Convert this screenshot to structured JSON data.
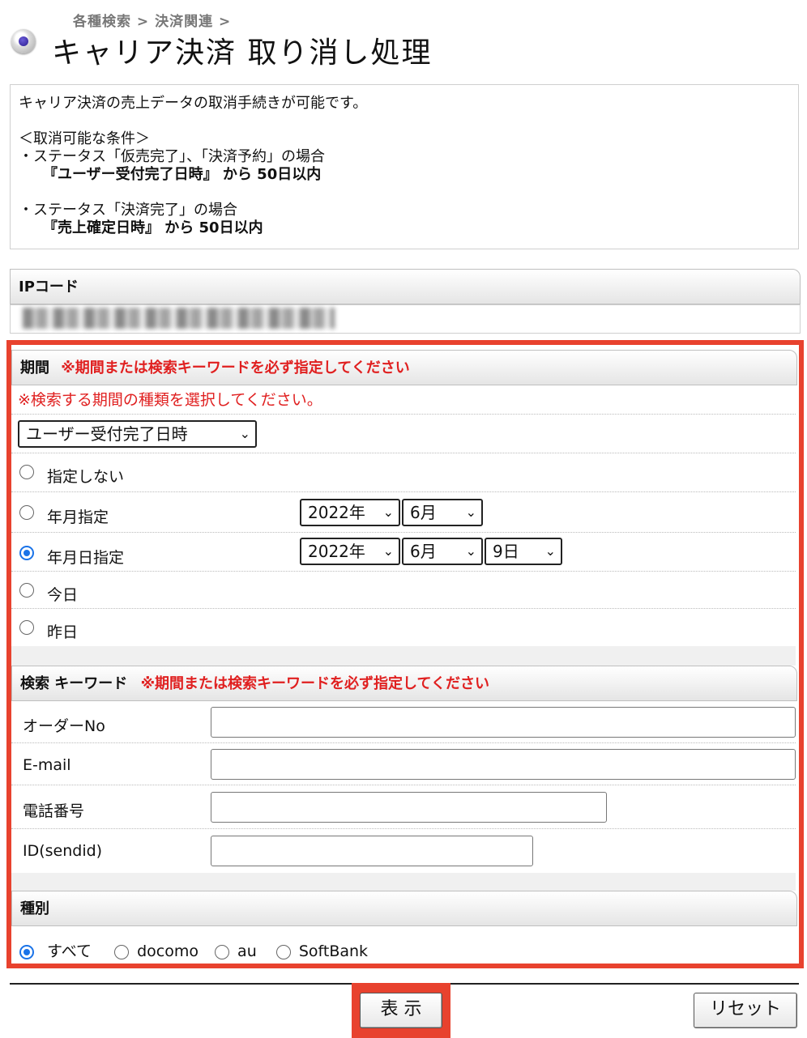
{
  "breadcrumb": "各種検索 > 決済関連 >",
  "title": "キャリア決済 取り消し処理",
  "info": {
    "line1": "キャリア決済の売上データの取消手続きが可能です。",
    "conditions_header": "＜取消可能な条件＞",
    "cond1": "・ステータス「仮売完了」、「決済予約」の場合",
    "cond1_detail": "『ユーザー受付完了日時』 から 50日以内",
    "cond2": "・ステータス「決済完了」の場合",
    "cond2_detail": "『売上確定日時』 から 50日以内"
  },
  "ip_section": {
    "label": "IPコード"
  },
  "period": {
    "label": "期間",
    "required_note": "※期間または検索キーワードを必ず指定してください",
    "select_note": "※検索する期間の種類を選択してください。",
    "type_select": "ユーザー受付完了日時",
    "options": [
      "指定しない",
      "年月指定",
      "年月日指定",
      "今日",
      "昨日"
    ],
    "selected": "年月日指定",
    "ym": {
      "year": "2022年",
      "month": "6月"
    },
    "ymd": {
      "year": "2022年",
      "month": "6月",
      "day": "9日"
    }
  },
  "keyword": {
    "label": "検索 キーワード",
    "required_note": "※期間または検索キーワードを必ず指定してください",
    "fields": [
      "オーダーNo",
      "E-mail",
      "電話番号",
      "ID(sendid)"
    ]
  },
  "type_section": {
    "label": "種別",
    "options": [
      "すべて",
      "docomo",
      "au",
      "SoftBank"
    ],
    "selected": "すべて"
  },
  "buttons": {
    "show": "表 示",
    "reset": "リセット"
  },
  "colors": {
    "highlight": "#e8422e",
    "required_text": "#e02020",
    "radio_selected": "#1a73e8"
  }
}
